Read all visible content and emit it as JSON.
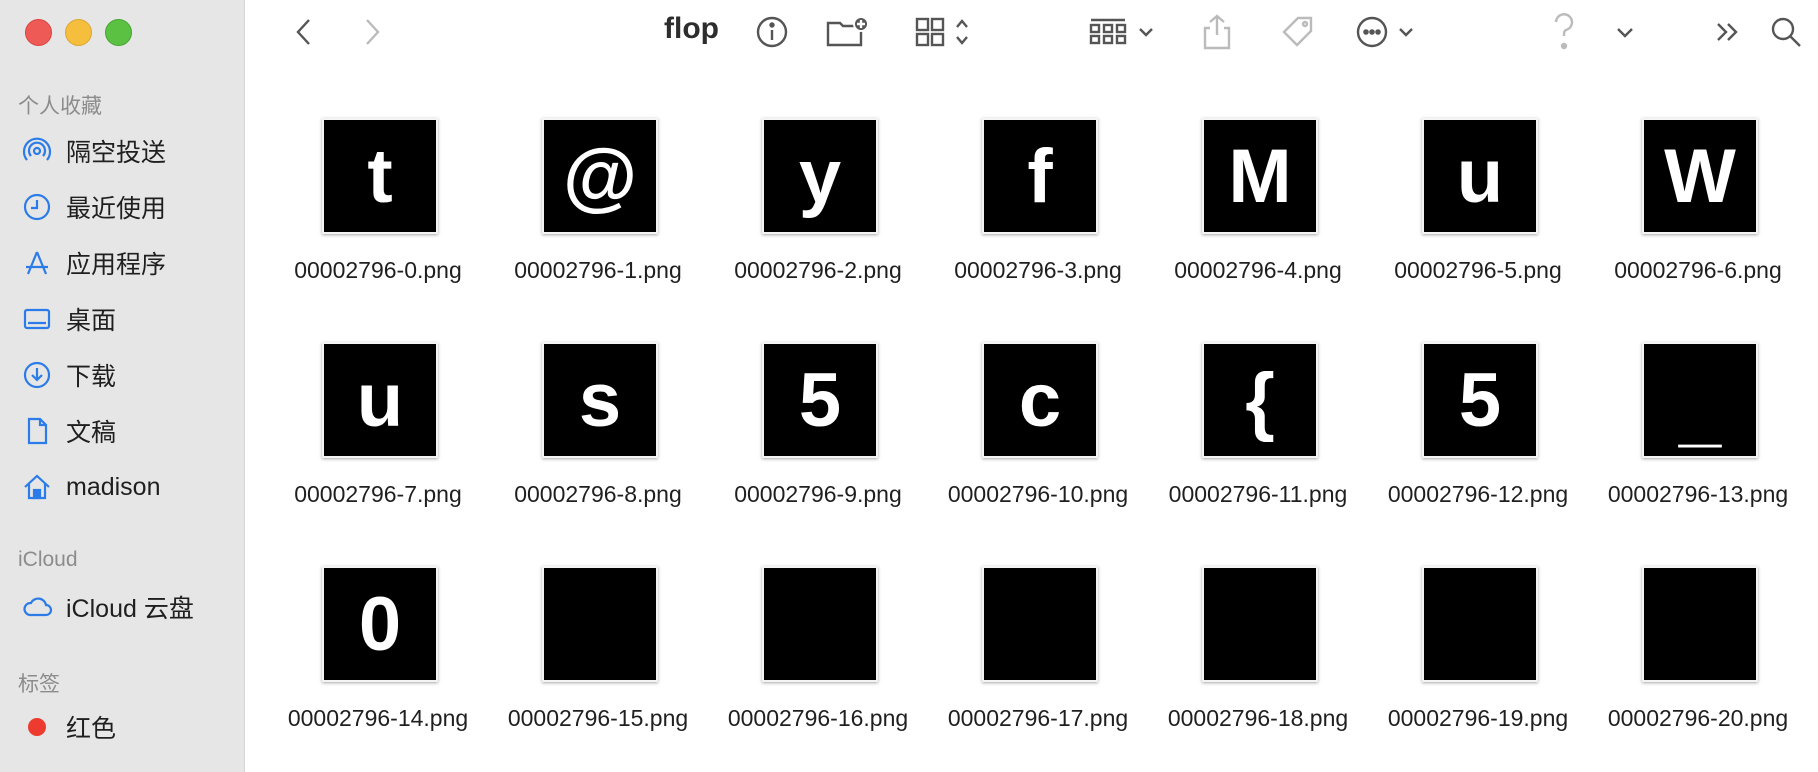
{
  "window": {
    "title": "flop"
  },
  "sidebar": {
    "favorites_label": "个人收藏",
    "favorites": [
      {
        "label": "隔空投送",
        "icon": "airdrop-icon"
      },
      {
        "label": "最近使用",
        "icon": "clock-icon"
      },
      {
        "label": "应用程序",
        "icon": "applications-icon"
      },
      {
        "label": "桌面",
        "icon": "desktop-icon"
      },
      {
        "label": "下载",
        "icon": "download-icon"
      },
      {
        "label": "文稿",
        "icon": "document-icon"
      },
      {
        "label": "madison",
        "icon": "home-icon"
      }
    ],
    "icloud_label": "iCloud",
    "icloud": [
      {
        "label": "iCloud 云盘",
        "icon": "cloud-icon"
      }
    ],
    "tags_label": "标签",
    "tags": [
      {
        "label": "红色",
        "color": "#ee3b30"
      }
    ]
  },
  "files": [
    {
      "name": "00002796-0.png",
      "glyph": "t"
    },
    {
      "name": "00002796-1.png",
      "glyph": "@"
    },
    {
      "name": "00002796-2.png",
      "glyph": "y"
    },
    {
      "name": "00002796-3.png",
      "glyph": "f"
    },
    {
      "name": "00002796-4.png",
      "glyph": "M"
    },
    {
      "name": "00002796-5.png",
      "glyph": "u"
    },
    {
      "name": "00002796-6.png",
      "glyph": "W"
    },
    {
      "name": "00002796-7.png",
      "glyph": "u"
    },
    {
      "name": "00002796-8.png",
      "glyph": "s"
    },
    {
      "name": "00002796-9.png",
      "glyph": "5"
    },
    {
      "name": "00002796-10.png",
      "glyph": "c"
    },
    {
      "name": "00002796-11.png",
      "glyph": "{"
    },
    {
      "name": "00002796-12.png",
      "glyph": "5"
    },
    {
      "name": "00002796-13.png",
      "glyph": "_"
    },
    {
      "name": "00002796-14.png",
      "glyph": "0"
    },
    {
      "name": "00002796-15.png",
      "glyph": ""
    },
    {
      "name": "00002796-16.png",
      "glyph": ""
    },
    {
      "name": "00002796-17.png",
      "glyph": ""
    },
    {
      "name": "00002796-18.png",
      "glyph": ""
    },
    {
      "name": "00002796-19.png",
      "glyph": ""
    },
    {
      "name": "00002796-20.png",
      "glyph": ""
    }
  ]
}
